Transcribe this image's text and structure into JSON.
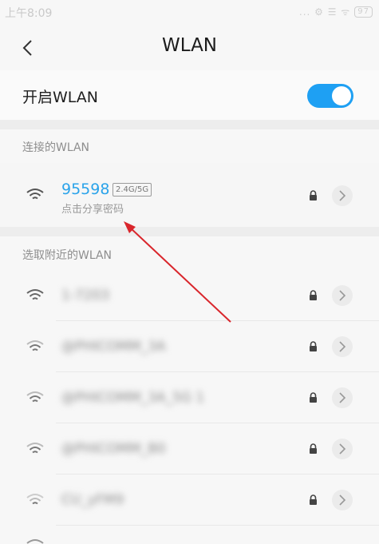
{
  "status_bar": {
    "time": "上午8:09",
    "icons": "... ⚙ ☰ ᯤ",
    "battery": "97"
  },
  "header": {
    "title": "WLAN",
    "back_icon": "chevron-left-icon"
  },
  "wlan_toggle": {
    "label": "开启WLAN",
    "state": "on",
    "accent_color": "#1ea0f3"
  },
  "connected_section": {
    "title": "连接的WLAN",
    "network": {
      "name": "95598",
      "band": "2.4G/5G",
      "subtitle": "点击分享密码",
      "name_color": "#2aa3ea"
    }
  },
  "nearby_section": {
    "title": "选取附近的WLAN",
    "networks": [
      {
        "name": "1-7203"
      },
      {
        "name": "@PHICOMM_3A"
      },
      {
        "name": "@PHICOMM_3A_5G 1"
      },
      {
        "name": "@PHICOMM_B0"
      },
      {
        "name": "CU_yFM9"
      }
    ]
  }
}
